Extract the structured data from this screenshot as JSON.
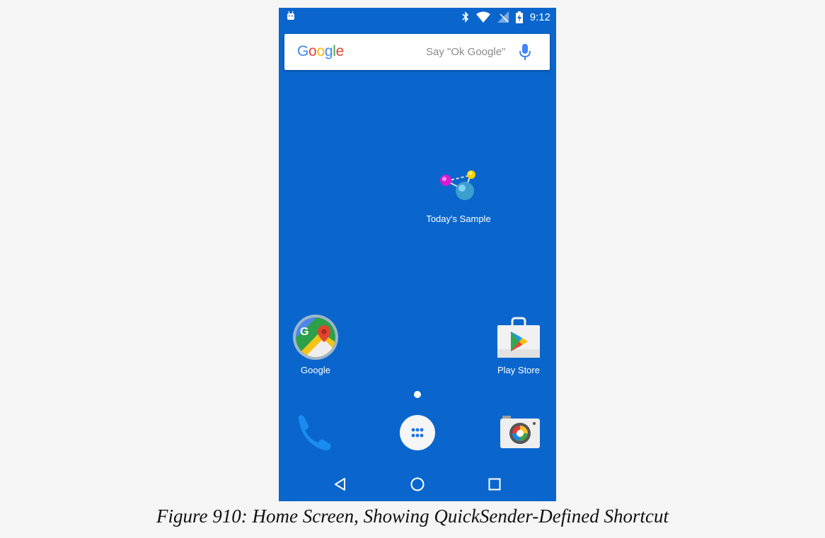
{
  "status_bar": {
    "time": "9:12",
    "icons": [
      "android-notification-icon",
      "bluetooth-icon",
      "wifi-icon",
      "no-signal-icon",
      "battery-charging-icon"
    ]
  },
  "search_widget": {
    "logo_text": "Google",
    "hint": "Say \"Ok Google\"",
    "logo_colors": [
      "#4285F4",
      "#EA4335",
      "#FBBC05",
      "#4285F4",
      "#34A853",
      "#EA4335"
    ]
  },
  "home": {
    "shortcut_label": "Today's Sample",
    "apps": [
      {
        "label": "Google",
        "icon": "google-maps-icon"
      },
      {
        "label": "Play Store",
        "icon": "play-store-icon"
      }
    ],
    "page_indicator_count": 1
  },
  "dock": {
    "icons": [
      "phone-icon",
      "app-drawer-icon",
      "camera-icon"
    ]
  },
  "nav_bar": {
    "icons": [
      "back-icon",
      "home-icon",
      "recents-icon"
    ]
  },
  "caption": "Figure 910: Home Screen, Showing QuickSender-Defined Shortcut",
  "colors": {
    "wallpaper": "#0a66cc",
    "page_background": "#f5f5f5"
  }
}
